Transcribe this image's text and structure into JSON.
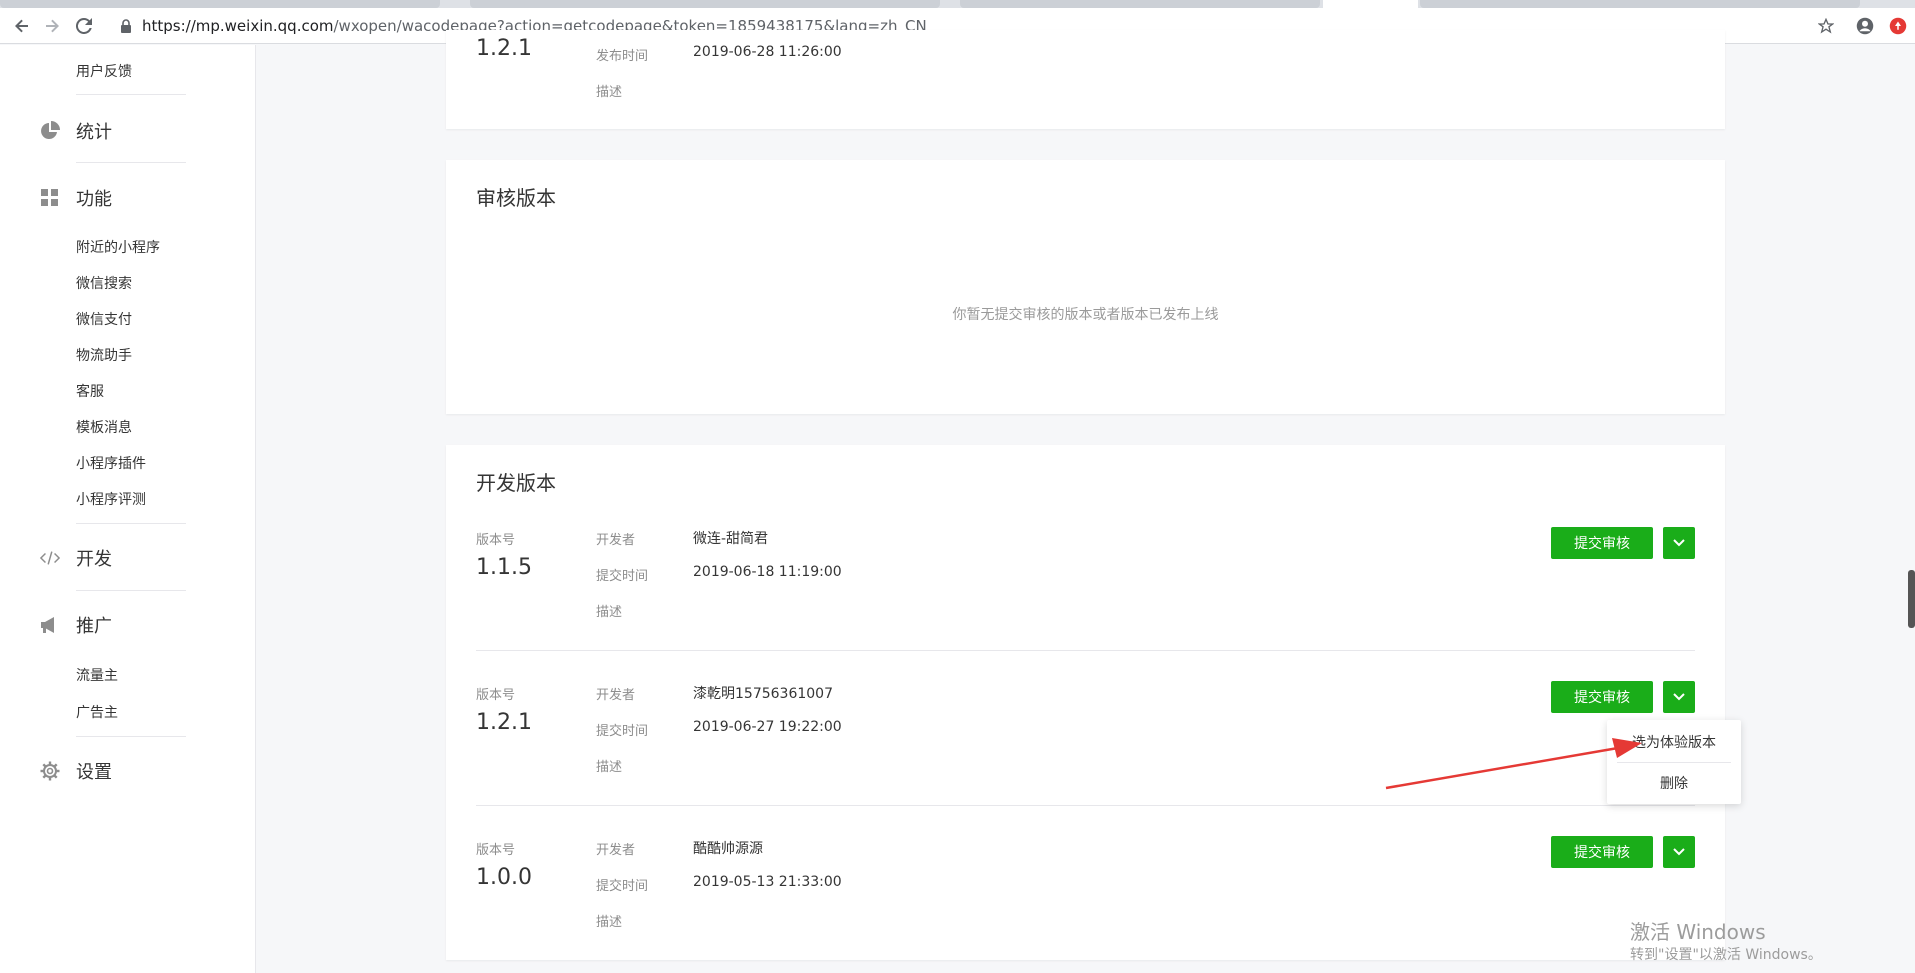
{
  "browser": {
    "url_host": "https://mp.weixin.qq.com",
    "url_path": "/wxopen/wacodepage?action=getcodepage&token=1859438175&lang=zh_CN"
  },
  "sidebar": {
    "top_item": "用户反馈",
    "stats": "统计",
    "features": "功能",
    "feature_items": [
      "附近的小程序",
      "微信搜索",
      "微信支付",
      "物流助手",
      "客服",
      "模板消息",
      "小程序插件",
      "小程序评测"
    ],
    "develop": "开发",
    "promote": "推广",
    "promote_items": [
      "流量主",
      "广告主"
    ],
    "settings": "设置"
  },
  "online_card": {
    "version_partial": "1.2.1",
    "publish_time_label": "发布时间",
    "publish_time": "2019-06-28 11:26:00",
    "desc_label": "描述"
  },
  "review_card": {
    "title": "审核版本",
    "empty_message": "你暂无提交审核的版本或者版本已发布上线"
  },
  "dev_card": {
    "title": "开发版本",
    "labels": {
      "version": "版本号",
      "developer": "开发者",
      "submit_time": "提交时间",
      "desc": "描述"
    },
    "submit_button": "提交审核",
    "versions": [
      {
        "version": "1.1.5",
        "developer": "微连-甜简君",
        "submit_time": "2019-06-18 11:19:00"
      },
      {
        "version": "1.2.1",
        "developer": "漆乾明15756361007",
        "submit_time": "2019-06-27 19:22:00"
      },
      {
        "version": "1.0.0",
        "developer": "酷酷帅源源",
        "submit_time": "2019-05-13 21:33:00"
      }
    ]
  },
  "dropdown": {
    "set_experience": "选为体验版本",
    "delete": "删除"
  },
  "watermark": {
    "line1": "激活 Windows",
    "line2": "转到\"设置\"以激活 Windows。"
  },
  "colors": {
    "accent_green": "#1aad19",
    "arrow_red": "#e53935"
  }
}
